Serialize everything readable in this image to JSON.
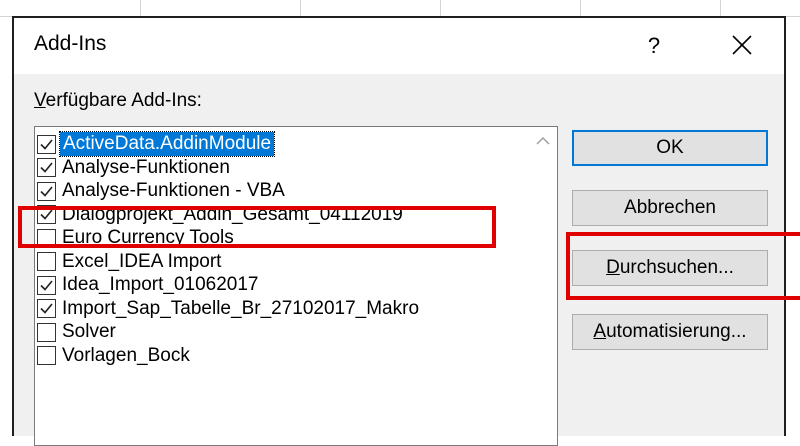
{
  "dialog": {
    "title": "Add-Ins",
    "help_label": "?",
    "close_icon": "close-icon"
  },
  "list": {
    "label_accesskey": "V",
    "label_rest": "erfügbare Add-Ins:",
    "items": [
      {
        "label": "ActiveData.AddinModule",
        "checked": true,
        "selected": true
      },
      {
        "label": "Analyse-Funktionen",
        "checked": true,
        "selected": false
      },
      {
        "label": "Analyse-Funktionen - VBA",
        "checked": true,
        "selected": false
      },
      {
        "label": "Dialogprojekt_Addin_Gesamt_04112019",
        "checked": true,
        "selected": false
      },
      {
        "label": "Euro Currency Tools",
        "checked": false,
        "selected": false
      },
      {
        "label": "Excel_IDEA Import",
        "checked": false,
        "selected": false
      },
      {
        "label": "Idea_Import_01062017",
        "checked": true,
        "selected": false
      },
      {
        "label": "Import_Sap_Tabelle_Br_27102017_Makro",
        "checked": true,
        "selected": false
      },
      {
        "label": "Solver",
        "checked": false,
        "selected": false
      },
      {
        "label": "Vorlagen_Bock",
        "checked": false,
        "selected": false
      }
    ]
  },
  "buttons": {
    "ok": "OK",
    "cancel": "Abbrechen",
    "browse_accesskey": "D",
    "browse_rest": "urchsuchen...",
    "automation_accesskey": "A",
    "automation_rest": "utomatisierung..."
  },
  "colors": {
    "highlight": "#e00000",
    "selection": "#0078d7"
  }
}
